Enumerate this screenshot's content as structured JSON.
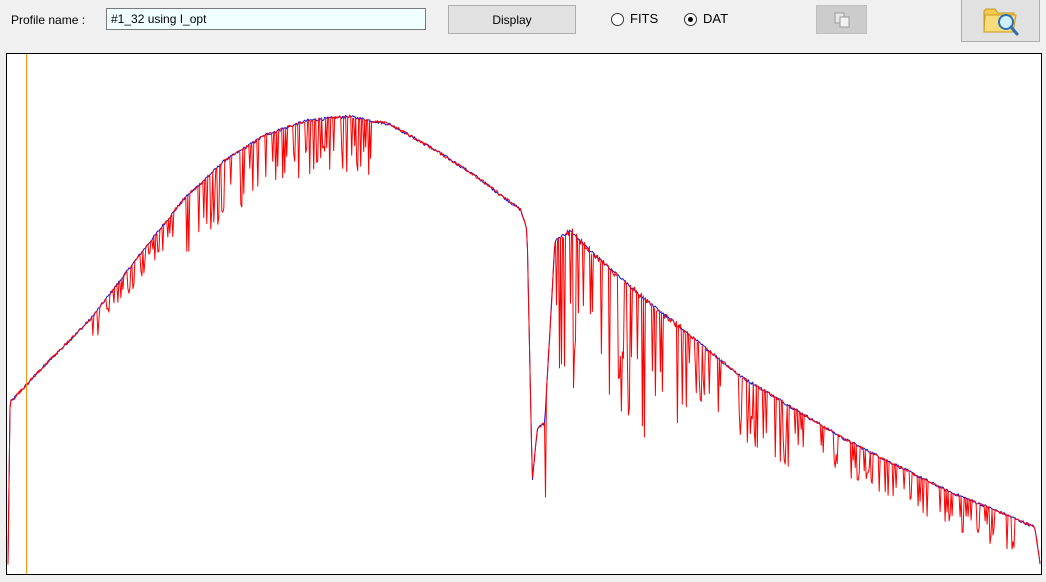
{
  "toolbar": {
    "profile_label": "Profile name :",
    "profile_value": "#1_32 using I_opt",
    "display_label": "Display",
    "radio_fits_label": "FITS",
    "radio_dat_label": "DAT",
    "selected_format": "DAT",
    "copy_icon": "copy-icon",
    "browse_icon": "folder-magnifier-icon"
  },
  "colors": {
    "observed_spectrum": "#ff0000",
    "model_spectrum": "#1010d0",
    "marker_line": "#ff8c00"
  },
  "chart_data": {
    "type": "line",
    "title": "",
    "xlabel": "",
    "ylabel": "",
    "grid": false,
    "series": [
      {
        "color": "#1010d0",
        "envelope": [
          [
            0.0,
            0.02
          ],
          [
            0.002,
            0.33
          ],
          [
            0.03,
            0.39
          ],
          [
            0.08,
            0.49
          ],
          [
            0.13,
            0.62
          ],
          [
            0.17,
            0.72
          ],
          [
            0.21,
            0.795
          ],
          [
            0.25,
            0.845
          ],
          [
            0.29,
            0.872
          ],
          [
            0.33,
            0.88
          ],
          [
            0.37,
            0.865
          ],
          [
            0.41,
            0.82
          ],
          [
            0.45,
            0.77
          ],
          [
            0.48,
            0.725
          ],
          [
            0.497,
            0.7
          ],
          [
            0.503,
            0.66
          ],
          [
            0.508,
            0.18
          ],
          [
            0.513,
            0.28
          ],
          [
            0.52,
            0.29
          ],
          [
            0.53,
            0.64
          ],
          [
            0.545,
            0.66
          ],
          [
            0.57,
            0.61
          ],
          [
            0.61,
            0.54
          ],
          [
            0.66,
            0.46
          ],
          [
            0.71,
            0.38
          ],
          [
            0.76,
            0.32
          ],
          [
            0.81,
            0.26
          ],
          [
            0.86,
            0.21
          ],
          [
            0.91,
            0.16
          ],
          [
            0.96,
            0.12
          ],
          [
            0.995,
            0.09
          ],
          [
            1.0,
            0.02
          ]
        ]
      },
      {
        "color": "#ff0000",
        "envelope": [
          [
            0.0,
            0.02
          ],
          [
            0.002,
            0.33
          ],
          [
            0.03,
            0.39
          ],
          [
            0.08,
            0.49
          ],
          [
            0.13,
            0.62
          ],
          [
            0.17,
            0.72
          ],
          [
            0.21,
            0.795
          ],
          [
            0.25,
            0.845
          ],
          [
            0.29,
            0.872
          ],
          [
            0.33,
            0.88
          ],
          [
            0.37,
            0.865
          ],
          [
            0.41,
            0.82
          ],
          [
            0.45,
            0.77
          ],
          [
            0.48,
            0.725
          ],
          [
            0.497,
            0.7
          ],
          [
            0.503,
            0.66
          ],
          [
            0.508,
            0.18
          ],
          [
            0.513,
            0.28
          ],
          [
            0.52,
            0.29
          ],
          [
            0.53,
            0.64
          ],
          [
            0.545,
            0.66
          ],
          [
            0.57,
            0.61
          ],
          [
            0.61,
            0.54
          ],
          [
            0.66,
            0.46
          ],
          [
            0.71,
            0.38
          ],
          [
            0.76,
            0.32
          ],
          [
            0.81,
            0.26
          ],
          [
            0.86,
            0.21
          ],
          [
            0.91,
            0.16
          ],
          [
            0.96,
            0.12
          ],
          [
            0.995,
            0.09
          ],
          [
            1.0,
            0.02
          ]
        ],
        "absorption_bands": [
          [
            0.08,
            0.16,
            0.05
          ],
          [
            0.17,
            0.36,
            0.11
          ],
          [
            0.52,
            0.55,
            0.3
          ],
          [
            0.55,
            0.66,
            0.27
          ],
          [
            0.66,
            0.76,
            0.12
          ],
          [
            0.76,
            0.98,
            0.07
          ]
        ]
      }
    ],
    "vertical_marker_x": 0.018
  }
}
